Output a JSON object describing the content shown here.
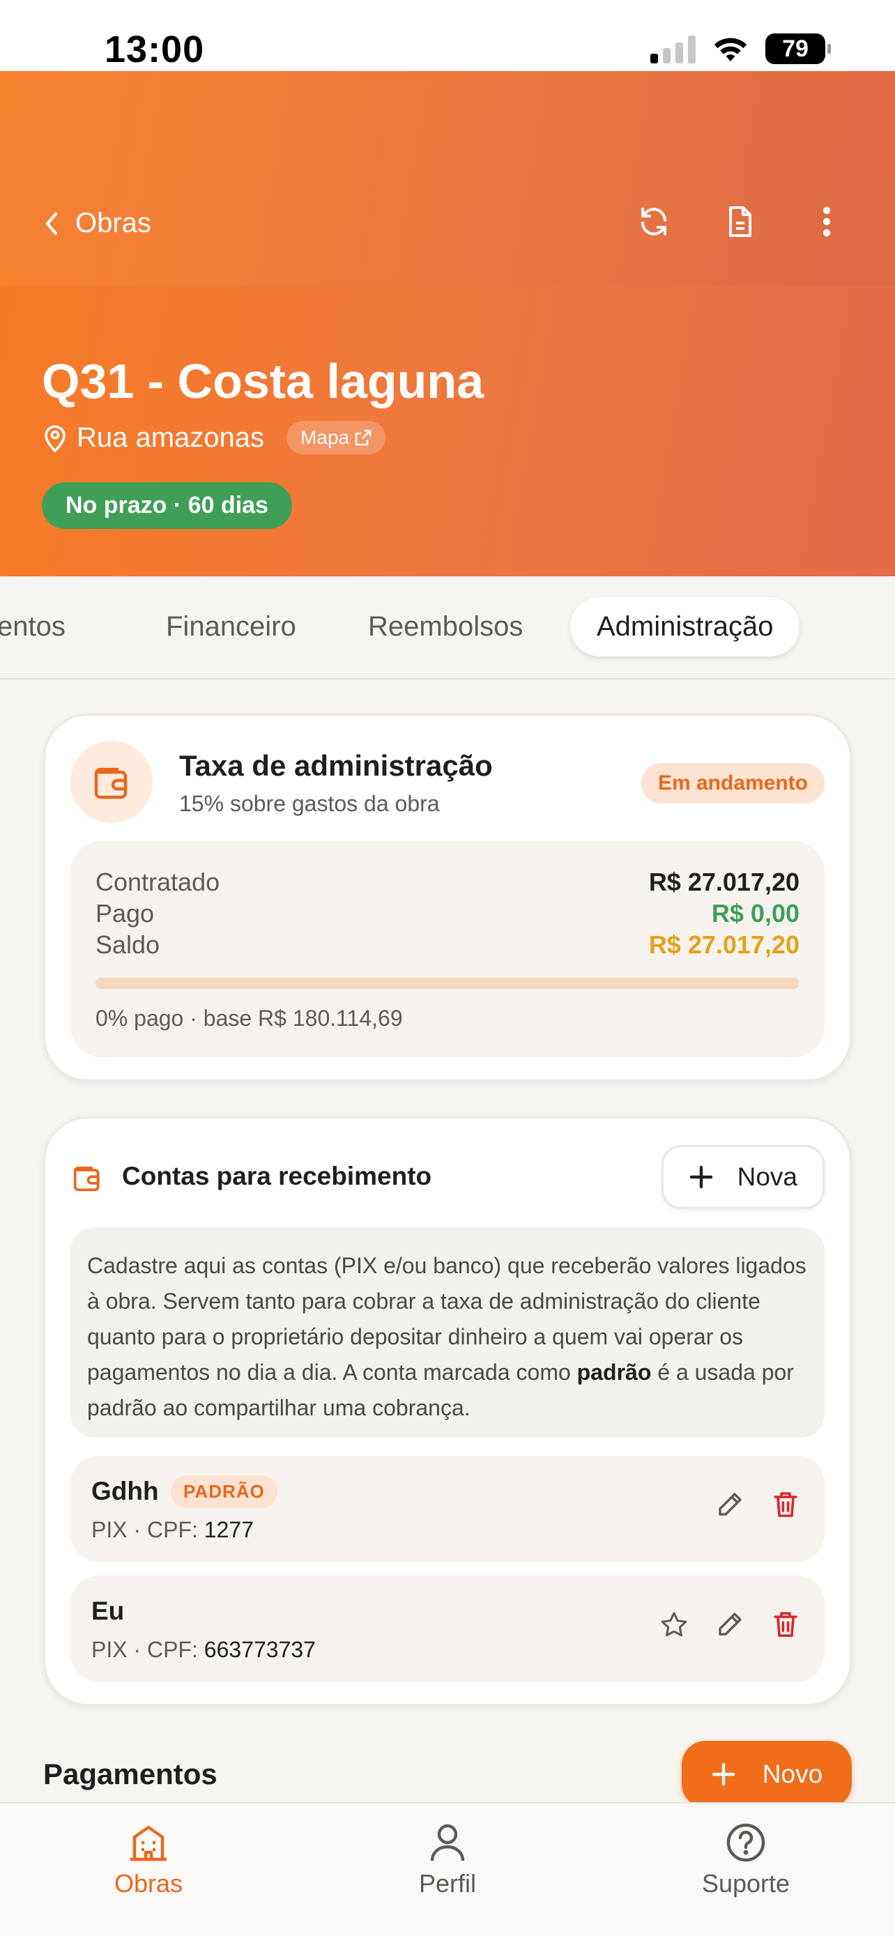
{
  "status_bar": {
    "time": "13:00",
    "battery": "79"
  },
  "header": {
    "back_label": "Obras",
    "title": "Q31 - Costa laguna",
    "address": "Rua amazonas",
    "map_label": "Mapa",
    "deadline_badge": "No prazo · 60 dias"
  },
  "tabs": [
    {
      "label": "entos"
    },
    {
      "label": "Financeiro"
    },
    {
      "label": "Reembolsos"
    },
    {
      "label": "Administração",
      "active": true
    }
  ],
  "admin_fee": {
    "title": "Taxa de administração",
    "subtitle": "15% sobre gastos da obra",
    "status": "Em andamento",
    "rows": [
      {
        "label": "Contratado",
        "value": "R$ 27.017,20",
        "color": "#1f1f1f"
      },
      {
        "label": "Pago",
        "value": "R$ 0,00",
        "color": "#3f9f57"
      },
      {
        "label": "Saldo",
        "value": "R$ 27.017,20",
        "color": "#e3a21a"
      }
    ],
    "paid_fraction": 0,
    "summary": "0% pago · base R$ 180.114,69"
  },
  "accounts": {
    "title": "Contas para recebimento",
    "new_button": "Nova",
    "info_part1": "Cadastre aqui as contas (PIX e/ou banco) que receberão valores ligados à obra. Servem tanto para cobrar a taxa de administração do cliente quanto para o proprietário depositar dinheiro a quem vai operar os pagamentos no dia a dia. A conta marcada como ",
    "info_bold": "padrão",
    "info_part2": " é a usada por padrão ao compartilhar uma cobrança.",
    "items": [
      {
        "name": "Gdhh",
        "badge": "PADRÃO",
        "detail_prefix": "PIX · CPF: ",
        "detail_value": "1277"
      },
      {
        "name": "Eu",
        "detail_prefix": "PIX · CPF: ",
        "detail_value": "663773737"
      }
    ]
  },
  "payments": {
    "title": "Pagamentos",
    "new_button": "Novo"
  },
  "bottom_nav": [
    {
      "label": "Obras",
      "icon": "building-icon",
      "active": true
    },
    {
      "label": "Perfil",
      "icon": "user-icon"
    },
    {
      "label": "Suporte",
      "icon": "help-icon"
    }
  ],
  "colors": {
    "accent": "#e8671d",
    "green": "#3f9f57",
    "amber": "#e3a21a",
    "danger": "#d8262b"
  }
}
